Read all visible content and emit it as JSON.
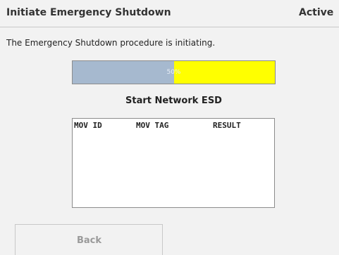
{
  "header": {
    "title": "Initiate Emergency Shutdown",
    "status": "Active"
  },
  "message": "The Emergency Shutdown procedure is initiating.",
  "progress": {
    "value_percent": 50,
    "label": "50%",
    "fill_color": "#a6b9cf",
    "track_color": "#ffff00"
  },
  "section": {
    "title": "Start Network ESD"
  },
  "results_table": {
    "columns": [
      "MOV ID",
      "MOV TAG",
      "RESULT"
    ],
    "rows": []
  },
  "buttons": {
    "back_label": "Back"
  }
}
